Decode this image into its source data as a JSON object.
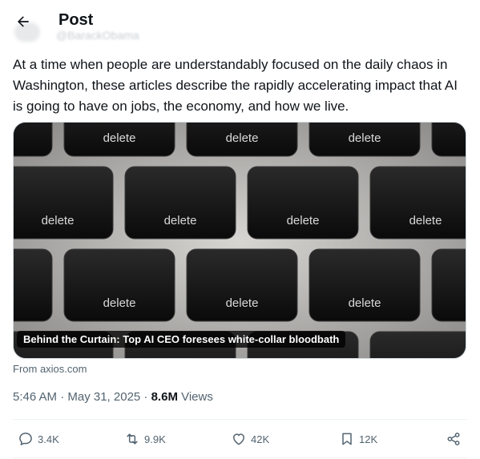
{
  "header": {
    "title": "Post",
    "ghost_handle": "@BarackObama"
  },
  "tweet": {
    "text": "At a time when people are understandably focused on the daily chaos in Washington, these articles describe the rapidly accelerating impact that AI is going to have on jobs, the economy, and how we live."
  },
  "card": {
    "caption": "Behind the Curtain: Top AI CEO foresees white-collar bloodbath",
    "key_label": "delete",
    "source": "From axios.com"
  },
  "meta": {
    "time": "5:46 AM · May 31, 2025 · ",
    "views_count": "8.6M",
    "views_label": " Views"
  },
  "actions": {
    "replies": "3.4K",
    "reposts": "9.9K",
    "likes": "42K",
    "bookmarks": "12K"
  },
  "icons": [
    "back-arrow-icon",
    "reply-icon",
    "repost-icon",
    "like-icon",
    "bookmark-icon",
    "share-icon"
  ]
}
